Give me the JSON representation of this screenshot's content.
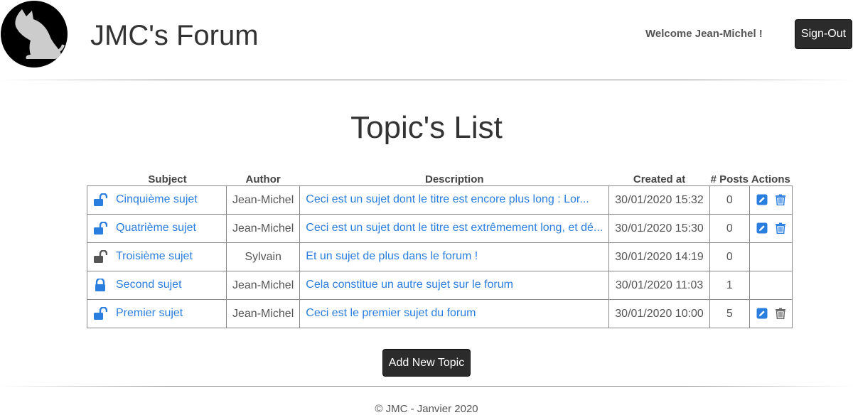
{
  "header": {
    "site_title": "JMC's Forum",
    "welcome": "Welcome Jean-Michel !",
    "signout_label": "Sign-Out"
  },
  "page_title": "Topic's List",
  "table": {
    "headers": [
      "Subject",
      "Author",
      "Description",
      "Created at",
      "# Posts",
      "Actions"
    ],
    "rows": [
      {
        "lock": "unlocked",
        "subject": "Cinquième sujet",
        "author": "Jean-Michel",
        "description": "Ceci est un sujet dont le titre est encore plus long : Lor...",
        "created_at": "30/01/2020 15:32",
        "posts": "0",
        "editable": true,
        "deletable": true,
        "delete_color": "#2a7ee0"
      },
      {
        "lock": "unlocked",
        "subject": "Quatrième sujet",
        "author": "Jean-Michel",
        "description": "Ceci est un sujet dont le titre est extrêmement long, et dé...",
        "created_at": "30/01/2020 15:30",
        "posts": "0",
        "editable": true,
        "deletable": true,
        "delete_color": "#2a7ee0"
      },
      {
        "lock": "unlocked-gray",
        "subject": "Troisième sujet",
        "author": "Sylvain",
        "description": "Et un sujet de plus dans le forum !",
        "created_at": "30/01/2020 14:19",
        "posts": "0",
        "editable": false,
        "deletable": false
      },
      {
        "lock": "locked",
        "subject": "Second sujet",
        "author": "Jean-Michel",
        "description": "Cela constitue un autre sujet sur le forum",
        "created_at": "30/01/2020 11:03",
        "posts": "1",
        "editable": false,
        "deletable": false
      },
      {
        "lock": "unlocked",
        "subject": "Premier sujet",
        "author": "Jean-Michel",
        "description": "Ceci est le premier sujet du forum",
        "created_at": "30/01/2020 10:00",
        "posts": "5",
        "editable": true,
        "deletable": true,
        "delete_color": "#666666"
      }
    ]
  },
  "add_topic_label": "Add New Topic",
  "footer": "© JMC - Janvier 2020",
  "colors": {
    "link": "#2a7ee0",
    "button_bg": "#2b2b2b",
    "lock_gray": "#555555"
  },
  "icons": {
    "logo": "cat-logo",
    "lock_unlocked": "lock-open-icon",
    "lock_locked": "lock-closed-icon",
    "edit": "edit-icon",
    "delete": "trash-icon"
  }
}
